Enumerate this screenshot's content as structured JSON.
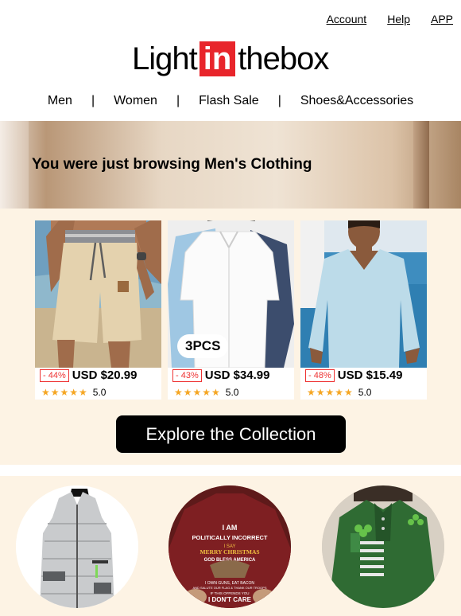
{
  "header": {
    "links": [
      "Account",
      "Help",
      "APP"
    ],
    "logo": {
      "pre": "Light",
      "mid": "in",
      "post": "thebox"
    }
  },
  "nav": {
    "items": [
      "Men",
      "Women",
      "Flash Sale",
      "Shoes&Accessories"
    ],
    "separator": "|"
  },
  "banner": {
    "title": "You were just browsing Men's Clothing"
  },
  "products": [
    {
      "discount": "- 44%",
      "price": "USD $20.99",
      "stars": "★★★★★",
      "rating": "5.0",
      "badge": ""
    },
    {
      "discount": "- 43%",
      "price": "USD $34.99",
      "stars": "★★★★★",
      "rating": "5.0",
      "badge": "3PCS"
    },
    {
      "discount": "- 48%",
      "price": "USD $15.49",
      "stars": "★★★★★",
      "rating": "5.0",
      "badge": ""
    }
  ],
  "cta": {
    "label": "Explore the Collection"
  },
  "categories": {
    "shirt_text": [
      "I AM",
      "POLITICALLY INCORRECT",
      "I SAY",
      "MERRY CHRISTMAS",
      "GOD BLESS AMERICA",
      "I OWN GUNS, EAT BACON",
      "AND SALUTE OUR FLAG & THANK OUR TROOPS",
      "IF THIS OFFENDS YOU",
      "I DON'T CARE"
    ]
  },
  "colors": {
    "brand_red": "#e8252b",
    "cream_bg": "#fdf3e4",
    "cta_bg": "#000000",
    "discount_red": "#e33333",
    "star": "#f5a623"
  }
}
